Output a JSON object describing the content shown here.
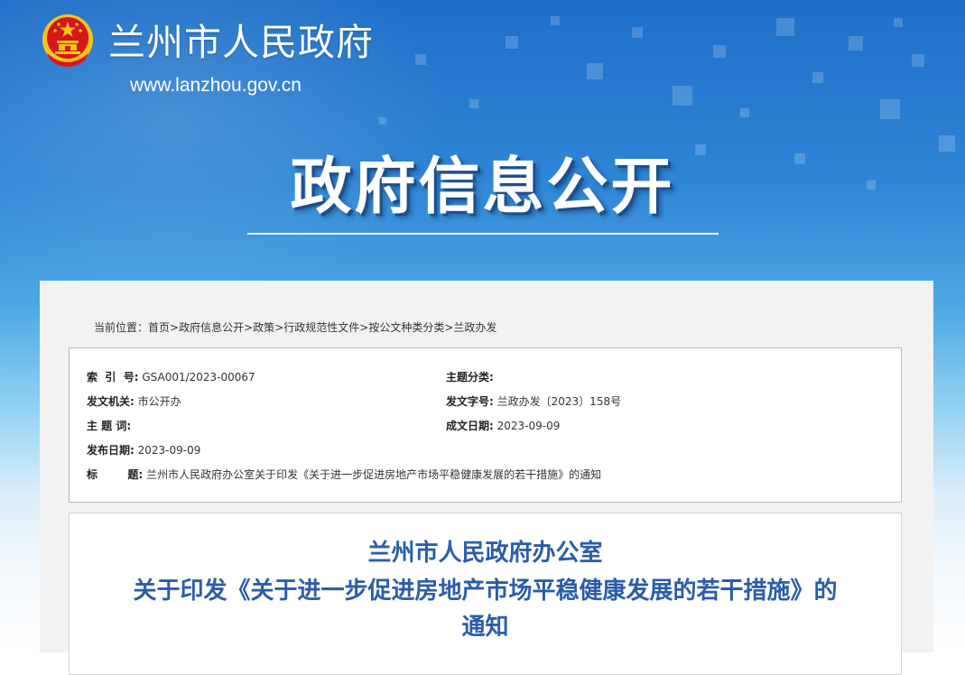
{
  "header": {
    "site_name": "兰州市人民政府",
    "site_url": "www.lanzhou.gov.cn",
    "page_heading": "政府信息公开"
  },
  "breadcrumb": {
    "prefix": "当前位置：",
    "items": [
      "首页",
      "政府信息公开",
      "政策",
      "行政规范性文件",
      "按公文种类分类",
      "兰政办发"
    ],
    "separator": ">"
  },
  "metadata": {
    "index_no": {
      "label": "索  引  号:",
      "value": "GSA001/2023-00067"
    },
    "topic_category": {
      "label": "主题分类:",
      "value": ""
    },
    "issuing_agency": {
      "label": "发文机关:",
      "value": "市公开办"
    },
    "document_number": {
      "label": "发文字号:",
      "value": "兰政办发〔2023〕158号"
    },
    "subject_words": {
      "label": "主 题 词:",
      "value": ""
    },
    "written_date": {
      "label": "成文日期:",
      "value": "2023-09-09"
    },
    "publish_date": {
      "label": "发布日期:",
      "value": "2023-09-09"
    },
    "title": {
      "label": "标        题:",
      "value": "兰州市人民政府办公室关于印发《关于进一步促进房地产市场平稳健康发展的若干措施》的通知"
    }
  },
  "document": {
    "title_line1": "兰州市人民政府办公室",
    "title_line2": "关于印发《关于进一步促进房地产市场平稳健康发展的若干措施》的",
    "title_line3": "通知"
  },
  "colors": {
    "banner_blue": "#2f86d6",
    "title_blue": "#2a5da8",
    "emblem_red": "#d6161b",
    "emblem_gold": "#f5c518"
  }
}
